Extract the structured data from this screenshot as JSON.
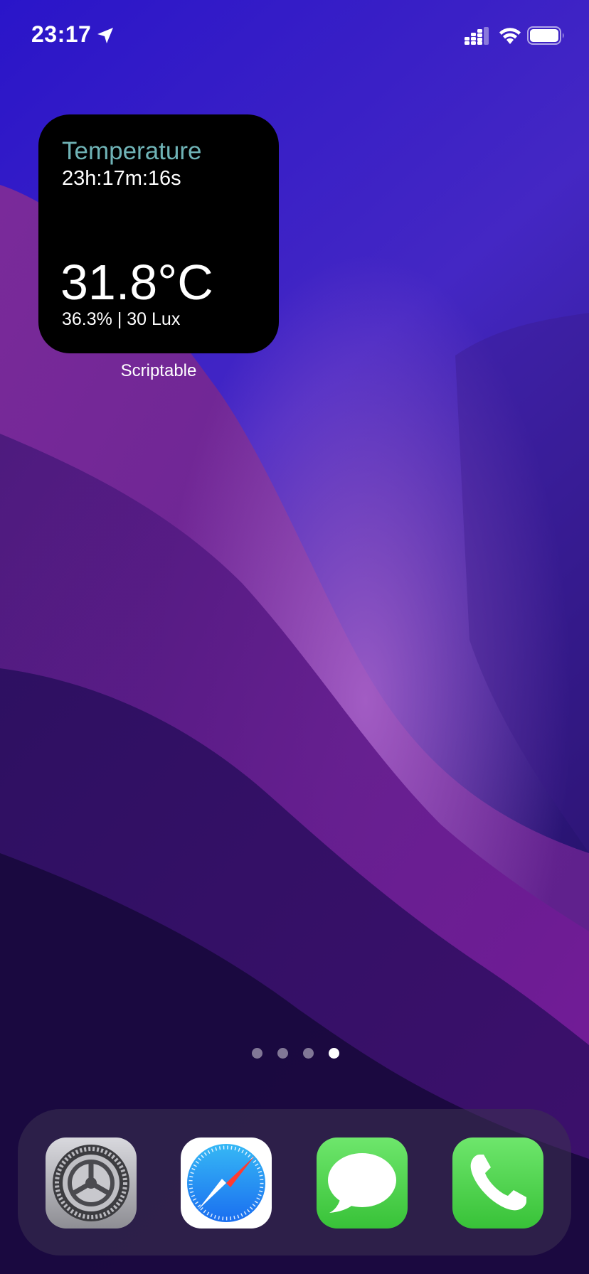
{
  "status_bar": {
    "time": "23:17"
  },
  "widget": {
    "title": "Temperature",
    "time": "23h:17m:16s",
    "temperature": "31.8°C",
    "details": "36.3% | 30 Lux",
    "app_label": "Scriptable"
  },
  "page_dots": {
    "count": 4,
    "active_index": 3
  },
  "dock": {
    "apps": [
      {
        "icon": "settings-icon"
      },
      {
        "icon": "safari-icon"
      },
      {
        "icon": "messages-icon"
      },
      {
        "icon": "phone-icon"
      }
    ]
  },
  "colors": {
    "widget_title": "#6fb3b6",
    "widget_bg": "#000000",
    "messages_green": "#5bd35a",
    "phone_green": "#5bd35a",
    "safari_blue": "#2e7ef5"
  }
}
